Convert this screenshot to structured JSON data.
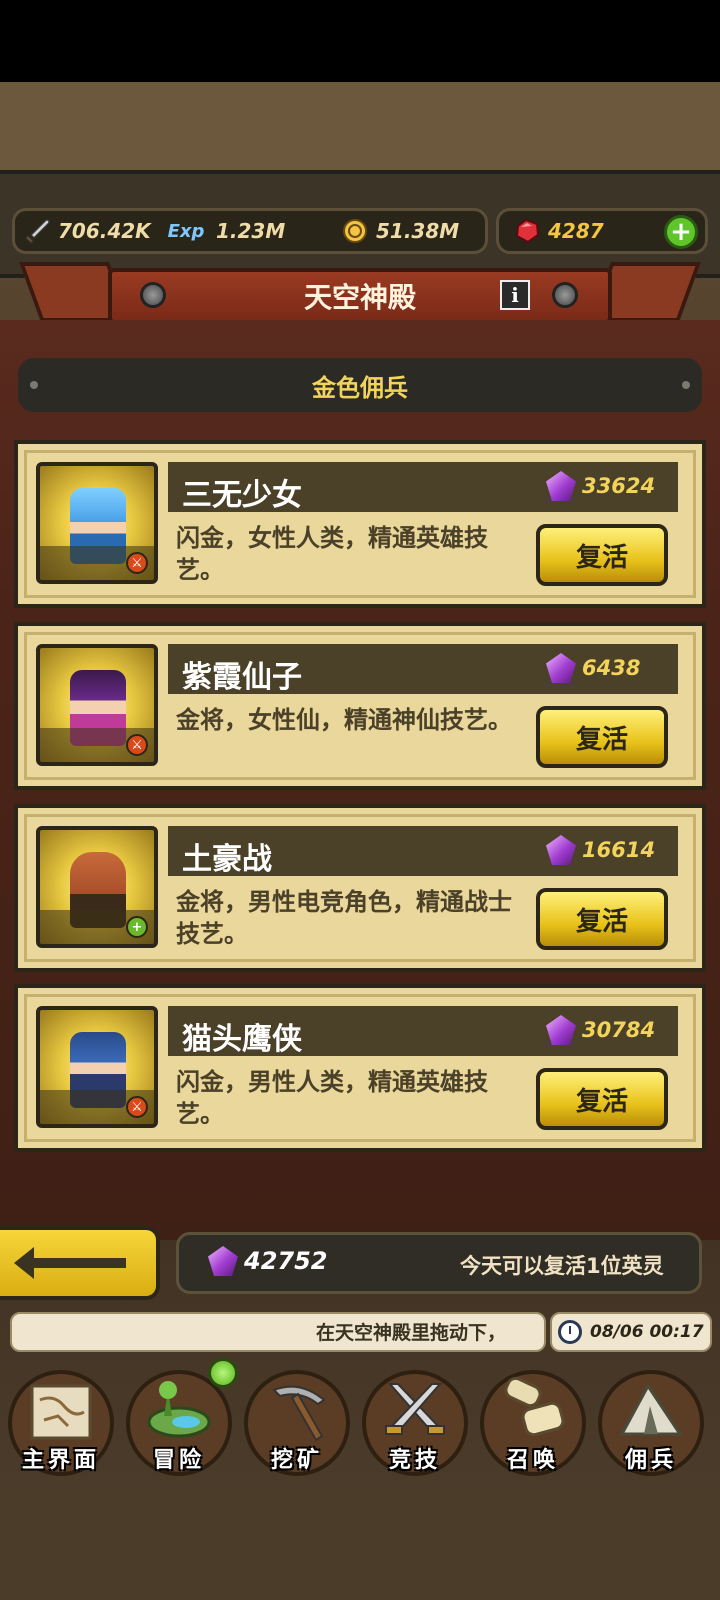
{
  "resources": {
    "attack": "706.42K",
    "exp": "1.23M",
    "gold": "51.38M",
    "gems": "4287"
  },
  "title": "天空神殿",
  "section": "金色佣兵",
  "heroes": [
    {
      "name": "三无少女",
      "cost": "33624",
      "desc": "闪金，女性人类，精通英雄技艺。",
      "action": "复活"
    },
    {
      "name": "紫霞仙子",
      "cost": "6438",
      "desc": "金将，女性仙，精通神仙技艺。",
      "action": "复活"
    },
    {
      "name": "土豪战",
      "cost": "16614",
      "desc": "金将，男性电竞角色，精通战士技艺。",
      "action": "复活"
    },
    {
      "name": "猫头鹰侠",
      "cost": "30784",
      "desc": "闪金，男性人类，精通英雄技艺。",
      "action": "复活"
    }
  ],
  "footer": {
    "gem_total": "42752",
    "revive_note": "今天可以复活1位英灵"
  },
  "ticker": {
    "message": "在天空神殿里拖动下，",
    "time": "08/06 00:17"
  },
  "nav": [
    {
      "label": "主界面",
      "icon": "map-scroll-icon"
    },
    {
      "label": "冒险",
      "icon": "island-icon"
    },
    {
      "label": "挖矿",
      "icon": "pickaxe-icon"
    },
    {
      "label": "竞技",
      "icon": "crossed-swords-icon"
    },
    {
      "label": "召唤",
      "icon": "summon-scroll-icon"
    },
    {
      "label": "佣兵",
      "icon": "tent-icon"
    }
  ],
  "colors": {
    "gold_text": "#f3d45a",
    "card_bg": "#e9d79c",
    "banner_red": "#9a3a22",
    "button_yellow": "#e8c21a"
  }
}
